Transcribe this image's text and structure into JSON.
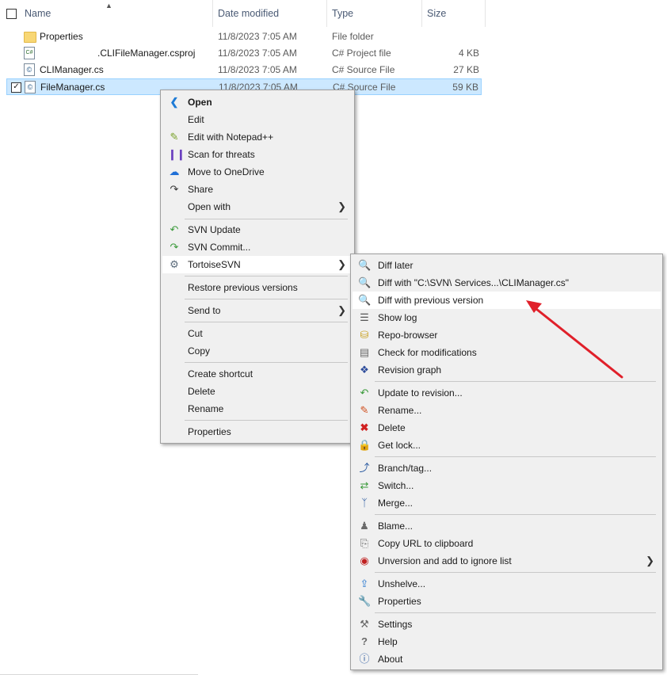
{
  "header": {
    "name": "Name",
    "date_modified": "Date modified",
    "type": "Type",
    "size": "Size"
  },
  "files": [
    {
      "name": "Properties",
      "date": "11/8/2023 7:05 AM",
      "type": "File folder",
      "size": "",
      "icon": "folder-icon"
    },
    {
      "name": ".CLIFileManager.csproj",
      "date": "11/8/2023 7:05 AM",
      "type": "C# Project file",
      "size": "4 KB",
      "icon": "csharp-project-icon"
    },
    {
      "name": "CLIManager.cs",
      "date": "11/8/2023 7:05 AM",
      "type": "C# Source File",
      "size": "27 KB",
      "icon": "csharp-file-icon"
    },
    {
      "name": "FileManager.cs",
      "date": "11/8/2023 7:05 AM",
      "type": "C# Source File",
      "size": "59 KB",
      "icon": "csharp-file-icon",
      "selected": true
    }
  ],
  "context_menu": {
    "open": "Open",
    "edit": "Edit",
    "edit_notepad": "Edit with Notepad++",
    "scan": "Scan for threats",
    "onedrive": "Move to OneDrive",
    "share": "Share",
    "open_with": "Open with",
    "svn_update": "SVN Update",
    "svn_commit": "SVN Commit...",
    "tortoise": "TortoiseSVN",
    "restore": "Restore previous versions",
    "send_to": "Send to",
    "cut": "Cut",
    "copy": "Copy",
    "create_shortcut": "Create shortcut",
    "delete": "Delete",
    "rename": "Rename",
    "properties": "Properties"
  },
  "svn_menu": {
    "diff_later": "Diff later",
    "diff_with": "Diff with \"C:\\SVN\\              Services...\\CLIManager.cs\"",
    "diff_prev": "Diff with previous version",
    "show_log": "Show log",
    "repo_browser": "Repo-browser",
    "check_mods": "Check for modifications",
    "revision_graph": "Revision graph",
    "update_rev": "Update to revision...",
    "rename": "Rename...",
    "delete": "Delete",
    "get_lock": "Get lock...",
    "branch_tag": "Branch/tag...",
    "switch": "Switch...",
    "merge": "Merge...",
    "blame": "Blame...",
    "copy_url": "Copy URL to clipboard",
    "unversion": "Unversion and add to ignore list",
    "unshelve": "Unshelve...",
    "properties": "Properties",
    "settings": "Settings",
    "help": "Help",
    "about": "About"
  },
  "annotation": {
    "arrow_color": "#e0202a"
  }
}
